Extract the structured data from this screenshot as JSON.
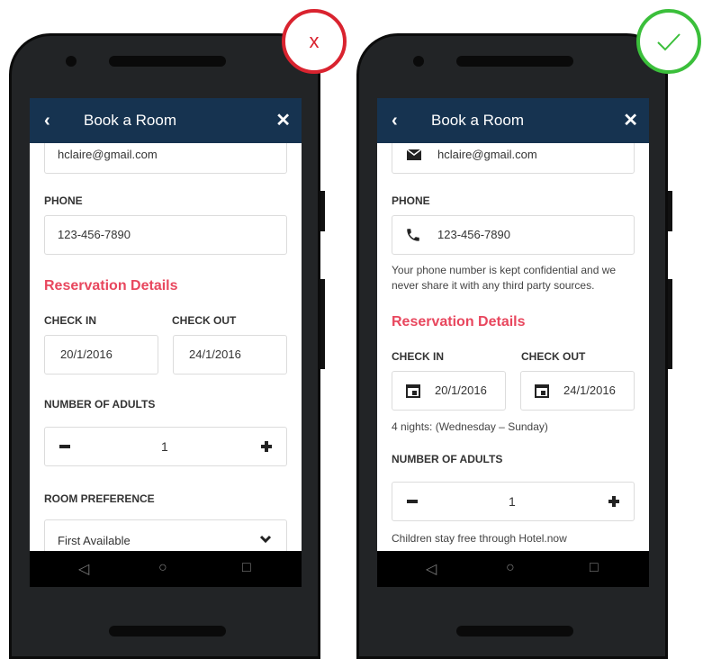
{
  "appbar": {
    "title": "Book a Room",
    "back_icon": "‹",
    "close_icon": "✕"
  },
  "nav": {
    "back": "◁",
    "home": "○",
    "recent": "□"
  },
  "badges": {
    "wrong": "x",
    "right": "✓",
    "wrong_color": "#d9232f",
    "right_color": "#3bbf3b"
  },
  "left": {
    "email_value": "hclaire@gmail.com",
    "phone_label": "PHONE",
    "phone_value": "123-456-7890",
    "section_title": "Reservation Details",
    "checkin_label": "CHECK IN",
    "checkout_label": "CHECK OUT",
    "checkin_value": "20/1/2016",
    "checkout_value": "24/1/2016",
    "adults_label": "NUMBER OF ADULTS",
    "adults_value": "1",
    "room_label": "ROOM PREFERENCE",
    "room_value": "First Available"
  },
  "right": {
    "email_value": "hclaire@gmail.com",
    "phone_label": "PHONE",
    "phone_value": "123-456-7890",
    "phone_hint": "Your phone number is kept confidential and we never share it with any third party sources.",
    "section_title": "Reservation Details",
    "checkin_label": "CHECK IN",
    "checkout_label": "CHECK OUT",
    "checkin_value": "20/1/2016",
    "checkout_value": "24/1/2016",
    "nights_hint": "4 nights: (Wednesday – Sunday)",
    "adults_label": "NUMBER OF ADULTS",
    "adults_value": "1",
    "children_hint": "Children stay free through Hotel.now"
  },
  "colors": {
    "appbar": "#163350",
    "accent": "#e8475e"
  }
}
